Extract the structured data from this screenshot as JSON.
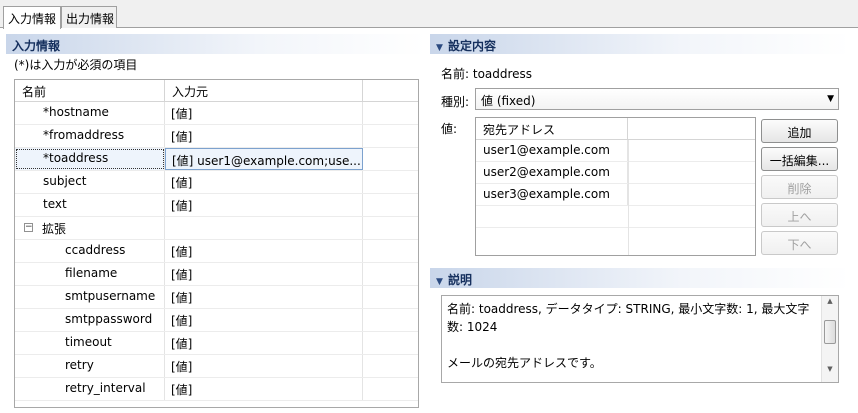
{
  "tabs": [
    {
      "label": "入力情報",
      "active": true
    },
    {
      "label": "出力情報",
      "active": false
    }
  ],
  "input_section": {
    "title": "入力情報",
    "required_note": "(*)は入力が必須の項目",
    "columns": [
      "名前",
      "入力元"
    ],
    "rows": [
      {
        "name": "*hostname",
        "source": "[値]"
      },
      {
        "name": "*fromaddress",
        "source": "[値]"
      },
      {
        "name": "*toaddress",
        "source": "[値] user1@example.com;use...",
        "selected": true
      },
      {
        "name": "subject",
        "source": "[値]"
      },
      {
        "name": "text",
        "source": "[値]"
      },
      {
        "name": "拡張",
        "source": "",
        "group": true,
        "expander": "−"
      },
      {
        "name": "ccaddress",
        "source": "[値]"
      },
      {
        "name": "filename",
        "source": "[値]"
      },
      {
        "name": "smtpusername",
        "source": "[値]"
      },
      {
        "name": "smtppassword",
        "source": "[値]"
      },
      {
        "name": "timeout",
        "source": "[値]"
      },
      {
        "name": "retry",
        "source": "[値]"
      },
      {
        "name": "retry_interval",
        "source": "[値]"
      }
    ]
  },
  "settings": {
    "title": "設定内容",
    "name_line": "名前: toaddress",
    "type_label": "種別:",
    "type_value": "値 (fixed)",
    "value_label": "値:",
    "table_header": "宛先アドレス",
    "values": [
      "user1@example.com",
      "user2@example.com",
      "user3@example.com"
    ],
    "buttons": [
      {
        "label": "追加",
        "enabled": true
      },
      {
        "label": "一括編集...",
        "enabled": true
      },
      {
        "label": "削除",
        "enabled": false
      },
      {
        "label": "上へ",
        "enabled": false
      },
      {
        "label": "下へ",
        "enabled": false
      }
    ]
  },
  "description": {
    "title": "説明",
    "line1": "名前: toaddress, データタイプ: STRING, 最小文字数: 1, 最大文字数: 1024",
    "line2": "メールの宛先アドレスです。"
  },
  "icons": {
    "collapse": "triangle-down-icon",
    "dropdown": "chevron-down-icon",
    "tree_expander": "minus-box-icon"
  }
}
